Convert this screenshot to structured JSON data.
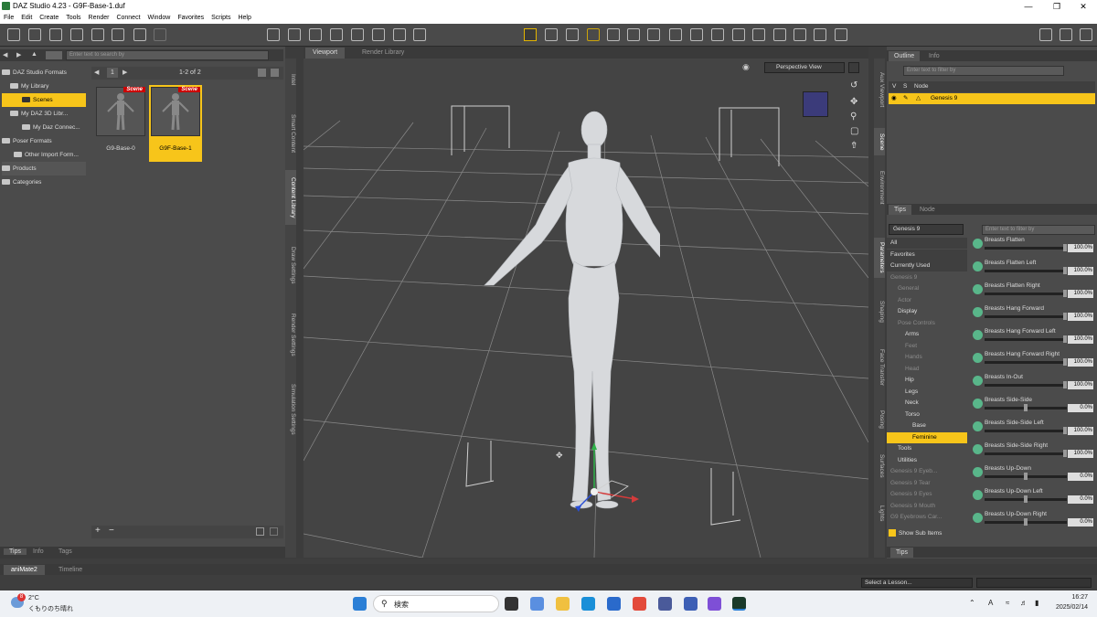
{
  "window": {
    "title": "DAZ Studio 4.23 - G9F-Base-1.duf"
  },
  "menu": [
    "File",
    "Edit",
    "Create",
    "Tools",
    "Render",
    "Connect",
    "Window",
    "Favorites",
    "Scripts",
    "Help"
  ],
  "content_library": {
    "search_placeholder": "Enter text to search by",
    "page_indicator": "1-2 of 2",
    "page_number": "1",
    "tree": [
      {
        "label": "DAZ Studio Formats",
        "level": 0
      },
      {
        "label": "My Library",
        "level": 1
      },
      {
        "label": "Scenes",
        "level": 2,
        "selected": true
      },
      {
        "label": "My DAZ 3D Libr...",
        "level": 1
      },
      {
        "label": "My Daz Connec...",
        "level": 1
      },
      {
        "label": "Poser Formats",
        "level": 0
      },
      {
        "label": "Other Import Form...",
        "level": 0
      },
      {
        "label": "Products",
        "level": 0
      },
      {
        "label": "Categories",
        "level": 0
      }
    ],
    "items": [
      {
        "label": "G9-Base-0",
        "badge": "Scene"
      },
      {
        "label": "G9F-Base-1",
        "badge": "Scene",
        "selected": true
      }
    ],
    "bottom_tabs": [
      "Tips",
      "Info",
      "Tags"
    ],
    "side_tabs": [
      "Intel",
      "Smart Content",
      "Content Library",
      "Draw Settings",
      "Render Settings",
      "Simulation Settings"
    ]
  },
  "viewport": {
    "tabs": [
      "Viewport",
      "Render Library"
    ],
    "camera": "Perspective View"
  },
  "scene": {
    "tabs": [
      "Outline",
      "Info"
    ],
    "filter_placeholder": "Enter text to filter by",
    "columns": [
      "V",
      "S",
      "Node"
    ],
    "node": "Genesis 9",
    "side_tabs": [
      "Aux Viewport",
      "Scene",
      "Environment"
    ]
  },
  "parameters": {
    "tabs": [
      "Tips",
      "Node"
    ],
    "selected_node": "Genesis 9",
    "filter_placeholder": "Enter text to filter by",
    "groups": [
      {
        "label": "All",
        "indent": 0
      },
      {
        "label": "Favorites",
        "indent": 0
      },
      {
        "label": "Currently Used",
        "indent": 0
      },
      {
        "label": "Genesis 9",
        "indent": 0,
        "dim": true
      },
      {
        "label": "General",
        "indent": 1,
        "dim": true
      },
      {
        "label": "Actor",
        "indent": 1,
        "dim": true
      },
      {
        "label": "Display",
        "indent": 1
      },
      {
        "label": "Pose Controls",
        "indent": 1,
        "dim": true
      },
      {
        "label": "Arms",
        "indent": 2
      },
      {
        "label": "Feet",
        "indent": 2,
        "dim": true
      },
      {
        "label": "Hands",
        "indent": 2,
        "dim": true
      },
      {
        "label": "Head",
        "indent": 2,
        "dim": true
      },
      {
        "label": "Hip",
        "indent": 2
      },
      {
        "label": "Legs",
        "indent": 2
      },
      {
        "label": "Neck",
        "indent": 2
      },
      {
        "label": "Torso",
        "indent": 2
      },
      {
        "label": "Base",
        "indent": 3
      },
      {
        "label": "Feminine",
        "indent": 3,
        "selected": true
      },
      {
        "label": "Tools",
        "indent": 1
      },
      {
        "label": "Utilities",
        "indent": 1
      },
      {
        "label": "Genesis 9 Eyeb...",
        "indent": 0,
        "dim": true
      },
      {
        "label": "Genesis 9 Tear",
        "indent": 0,
        "dim": true
      },
      {
        "label": "Genesis 9 Eyes",
        "indent": 0,
        "dim": true
      },
      {
        "label": "Genesis 9 Mouth",
        "indent": 0,
        "dim": true
      },
      {
        "label": "G9 Eyebrows Car...",
        "indent": 0,
        "dim": true
      }
    ],
    "show_sub_items": "Show Sub Items",
    "items": [
      {
        "name": "Breasts Flatten",
        "value": "100.0%",
        "pos": 1.0
      },
      {
        "name": "Breasts Flatten Left",
        "value": "100.0%",
        "pos": 1.0
      },
      {
        "name": "Breasts Flatten Right",
        "value": "100.0%",
        "pos": 1.0
      },
      {
        "name": "Breasts Hang Forward",
        "value": "100.0%",
        "pos": 1.0
      },
      {
        "name": "Breasts Hang Forward Left",
        "value": "100.0%",
        "pos": 1.0
      },
      {
        "name": "Breasts Hang Forward Right",
        "value": "100.0%",
        "pos": 1.0
      },
      {
        "name": "Breasts In-Out",
        "value": "100.0%",
        "pos": 1.0
      },
      {
        "name": "Breasts Side-Side",
        "value": "0.0%",
        "pos": 0.5
      },
      {
        "name": "Breasts Side-Side Left",
        "value": "100.0%",
        "pos": 1.0
      },
      {
        "name": "Breasts Side-Side Right",
        "value": "100.0%",
        "pos": 1.0
      },
      {
        "name": "Breasts Up-Down",
        "value": "0.0%",
        "pos": 0.5
      },
      {
        "name": "Breasts Up-Down Left",
        "value": "0.0%",
        "pos": 0.5
      },
      {
        "name": "Breasts Up-Down Right",
        "value": "0.0%",
        "pos": 0.5
      }
    ],
    "side_tabs": [
      "Parameters",
      "Shaping",
      "Face Transfer",
      "Posing",
      "Surfaces",
      "Lights"
    ],
    "bottom_tab": "Tips"
  },
  "timeline": {
    "tabs": [
      "aniMate2",
      "Timeline"
    ],
    "lesson": "Select a Lesson..."
  },
  "taskbar": {
    "weather_temp": "2°C",
    "weather_desc": "くもりのち晴れ",
    "weather_badge": "8",
    "search": "検索",
    "time": "16:27",
    "date": "2025/02/14"
  },
  "colors": {
    "accent": "#f7c51a",
    "badge": "#cc0000"
  }
}
